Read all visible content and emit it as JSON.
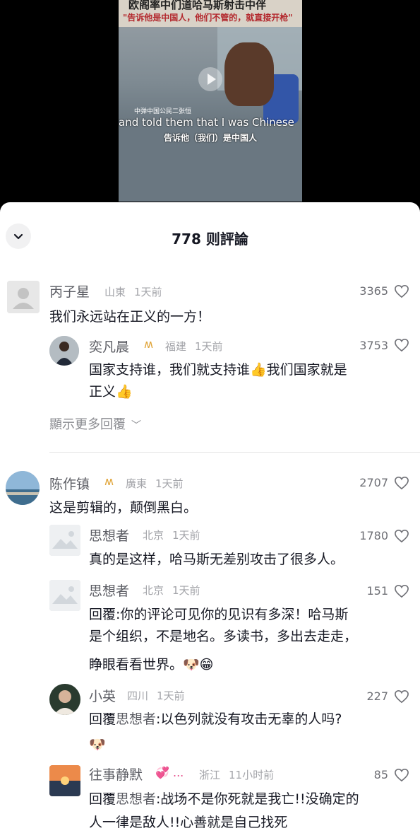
{
  "video": {
    "title_line1": "欧阁率中们道哈马斯射击中伴",
    "title_line2": "\"告诉他是中国人，他们不管的，就直接开枪\"",
    "watermark": "中弹中国公民二张恒",
    "subtitle_en": "and told them that I was Chinese",
    "subtitle_cn": "告诉他（我们）是中国人"
  },
  "sheet": {
    "title": "778 则評論",
    "collapse_icon": "chevron-down-icon"
  },
  "comments": [
    {
      "user": "丙子星",
      "location": "山東",
      "time": "1天前",
      "likes": "3365",
      "text": "我们永远站在正义的一方！",
      "avatar": "default-avatar",
      "replies": [
        {
          "user": "奕凡晨",
          "badge": "ʍ",
          "location": "福建",
          "time": "1天前",
          "likes": "3753",
          "text_line1": "国家支持谁，我们就支持谁👍我们国家就是",
          "text_line2": "正义👍"
        }
      ],
      "more_replies": "顯示更多回覆"
    },
    {
      "user": "陈作镇",
      "badge": "ʍ",
      "location": "廣東",
      "time": "1天前",
      "likes": "2707",
      "text": "这是剪辑的，颠倒黑白。",
      "replies": [
        {
          "user": "思想者",
          "location": "北京",
          "time": "1天前",
          "likes": "1780",
          "text": "真的是这样，哈马斯无差别攻击了很多人。"
        },
        {
          "user": "思想者",
          "location": "北京",
          "time": "1天前",
          "likes": "151",
          "text_line1": "回覆:你的评论可见你的见识有多深！哈马斯",
          "text_line2": "是个组织，不是地名。多读书，多出去走走，",
          "text_line3": "睁眼看看世界。🐶😁"
        },
        {
          "user": "小英",
          "location": "四川",
          "time": "1天前",
          "likes": "227",
          "reply_prefix": "回覆",
          "reply_target": "思想者",
          "text_line1": ":以色列就没有攻击无辜的人吗?",
          "text_line2": "🐶"
        },
        {
          "user": "往事静默",
          "badge": "💞 ...",
          "location": "浙江",
          "time": "11小时前",
          "likes": "85",
          "reply_prefix": "回覆",
          "reply_target": "思想者",
          "text_line1": ":战场不是你死就是我亡!!没确定的",
          "text_line2": "人一律是敌人!!心善就是自己找死"
        }
      ]
    }
  ],
  "colors": {
    "primary_text": "#161823",
    "username": "#5b5c63",
    "meta": "#a3a4a9",
    "badge": "#e0a53a"
  }
}
